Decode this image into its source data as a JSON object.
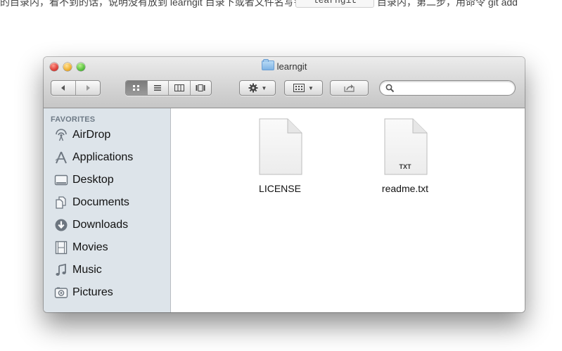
{
  "page": {
    "top_text_left": "的目录内，看不到的话，说明没有放到 learngit 目录下或者文件名写错了，或者",
    "top_code": "learngit",
    "top_text_right": "目录内，第二步，用命令 git add"
  },
  "window": {
    "title": "learngit",
    "toolbar": {
      "back_icon": "back-icon",
      "forward_icon": "forward-icon",
      "view_modes": [
        "icon-view",
        "list-view",
        "column-view",
        "cover-flow-view"
      ],
      "active_view": "icon-view",
      "action_icon": "gear-icon",
      "arrange_icon": "arrange-icon",
      "share_icon": "share-icon",
      "search_placeholder": ""
    },
    "sidebar": {
      "header": "FAVORITES",
      "items": [
        {
          "label": "AirDrop",
          "icon": "airdrop-icon"
        },
        {
          "label": "Applications",
          "icon": "applications-icon"
        },
        {
          "label": "Desktop",
          "icon": "desktop-icon"
        },
        {
          "label": "Documents",
          "icon": "documents-icon"
        },
        {
          "label": "Downloads",
          "icon": "downloads-icon"
        },
        {
          "label": "Movies",
          "icon": "movies-icon"
        },
        {
          "label": "Music",
          "icon": "music-icon"
        },
        {
          "label": "Pictures",
          "icon": "pictures-icon"
        }
      ]
    },
    "files": [
      {
        "name": "LICENSE",
        "badge": ""
      },
      {
        "name": "readme.txt",
        "badge": "TXT"
      }
    ]
  },
  "colors": {
    "sidebar_bg": "#dde4ea",
    "sidebar_header": "#6e7a86",
    "titlebar_top": "#ececec",
    "titlebar_bottom": "#c6c6c6"
  }
}
